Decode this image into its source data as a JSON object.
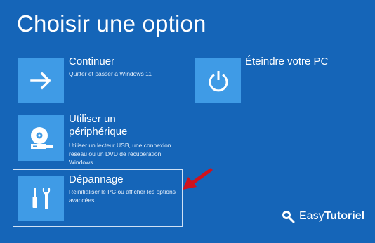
{
  "page": {
    "title": "Choisir une option"
  },
  "options": [
    {
      "title": "Continuer",
      "description": "Quitter et passer à Windows 11",
      "icon": "arrow-right-icon"
    },
    {
      "title": "Éteindre votre PC",
      "description": "",
      "icon": "power-icon"
    },
    {
      "title": "Utiliser un périphérique",
      "description": "Utiliser un lecteur USB, une connexion réseau ou un DVD de récupération Windows",
      "icon": "disc-drive-icon"
    },
    {
      "title": "Dépannage",
      "description": "Réinitialiser le PC ou afficher les options avancées",
      "icon": "tools-icon",
      "selected": true
    }
  ],
  "watermark": {
    "brand_prefix": "Easy",
    "brand_suffix": "Tutoriel"
  },
  "colors": {
    "background": "#1565b8",
    "tile": "#3f9be6",
    "annotation_arrow": "#d0121b"
  }
}
